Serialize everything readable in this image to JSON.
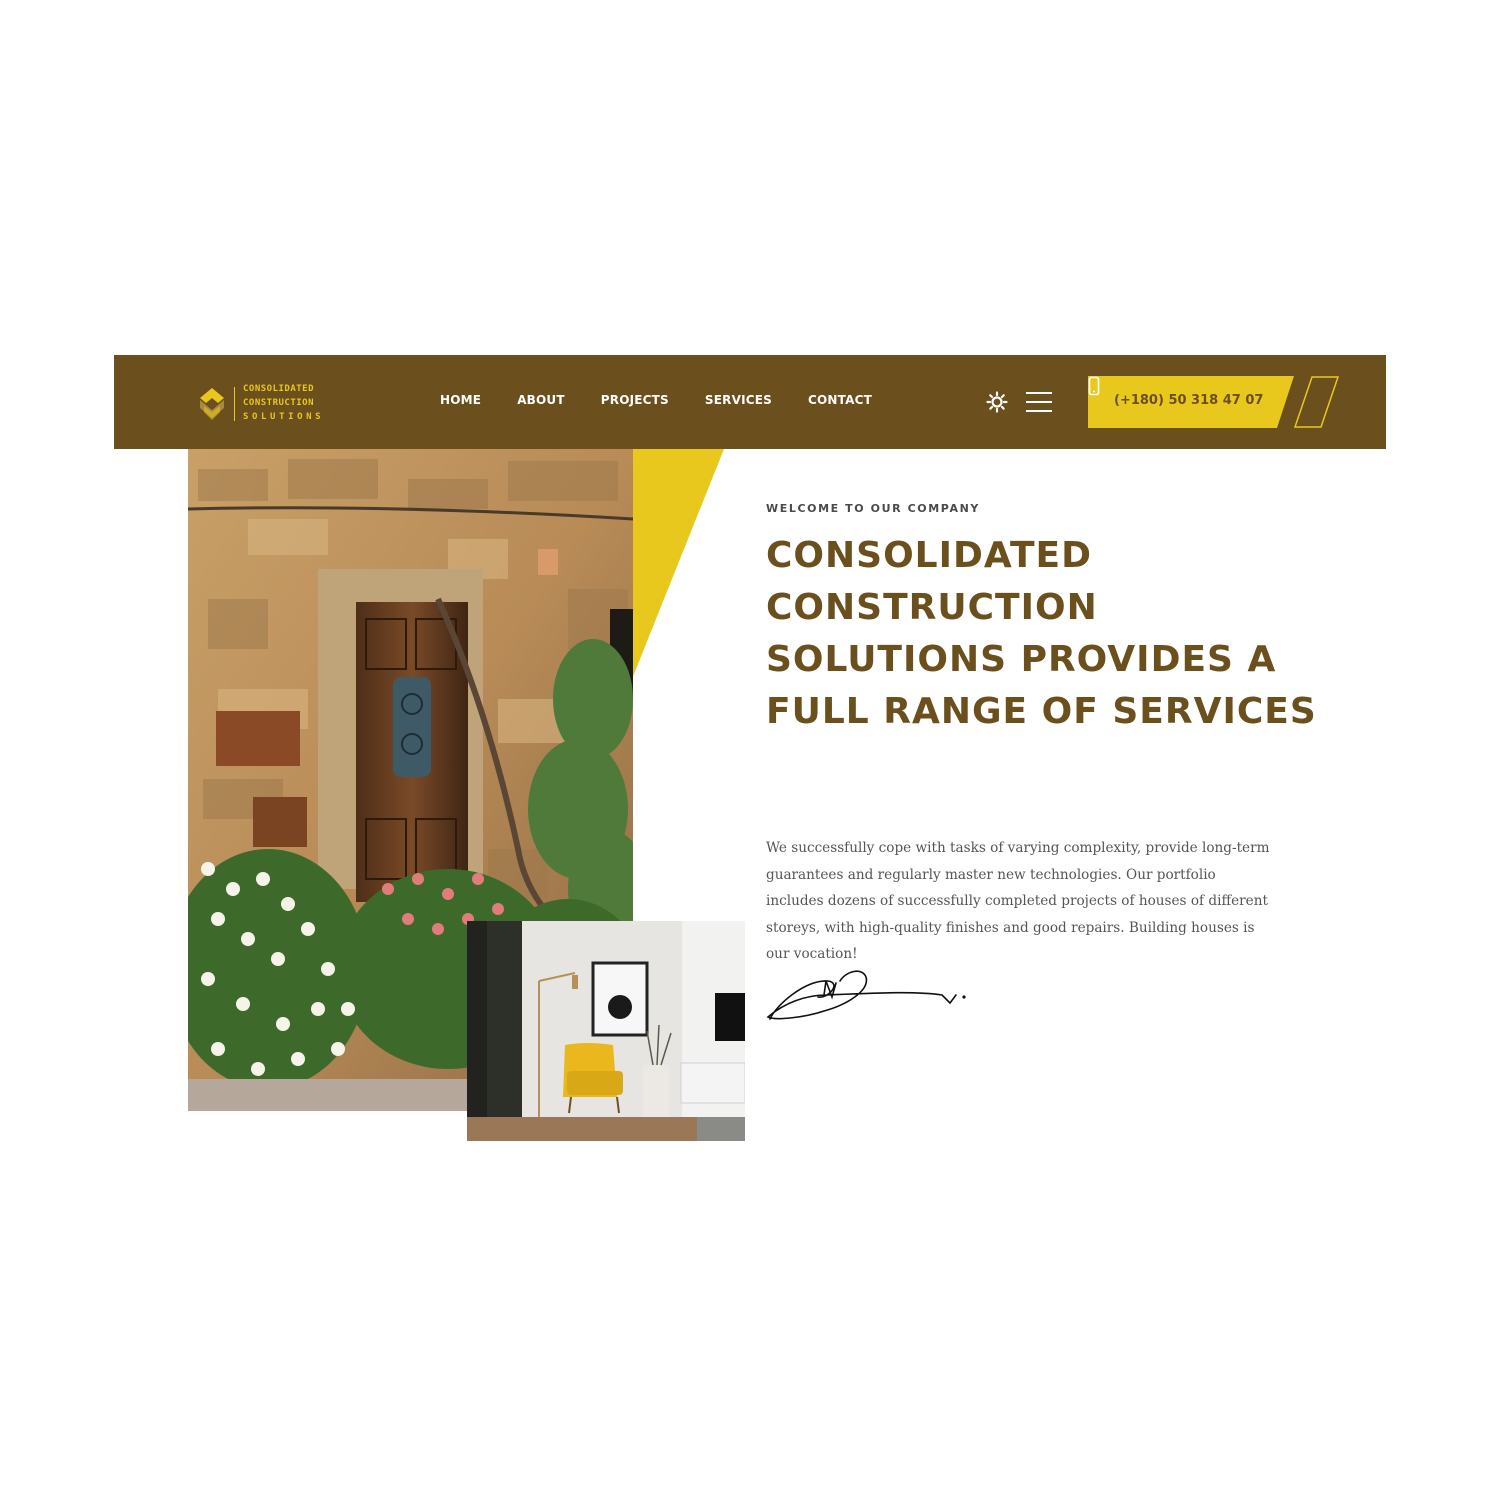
{
  "colors": {
    "brand_brown": "#6b4f1c",
    "accent_yellow": "#e9c81e",
    "text_gray": "#555555"
  },
  "logo": {
    "line1": "CONSOLIDATED",
    "line2": "CONSTRUCTION",
    "line3": "SOLUTIONS",
    "icon": "logo-mark-icon"
  },
  "nav": {
    "items": [
      "HOME",
      "ABOUT",
      "PROJECTS",
      "SERVICES",
      "CONTACT"
    ]
  },
  "header": {
    "theme_icon": "sun-icon",
    "menu_icon": "hamburger-menu-icon",
    "phone": "(+180) 50 318 47 07",
    "phone_icon": "mobile-phone-icon"
  },
  "hero": {
    "eyebrow": "WELCOME TO OUR COMPANY",
    "headline": "CONSOLIDATED CONSTRUCTION SOLUTIONS PROVIDES A FULL RANGE OF SERVICES",
    "description": "We successfully cope with tasks of varying complexity, provide long-term guarantees and regularly master new technologies. Our portfolio includes dozens of successfully completed projects of houses of different storeys, with high-quality finishes and good repairs. Building houses is our vocation!"
  }
}
